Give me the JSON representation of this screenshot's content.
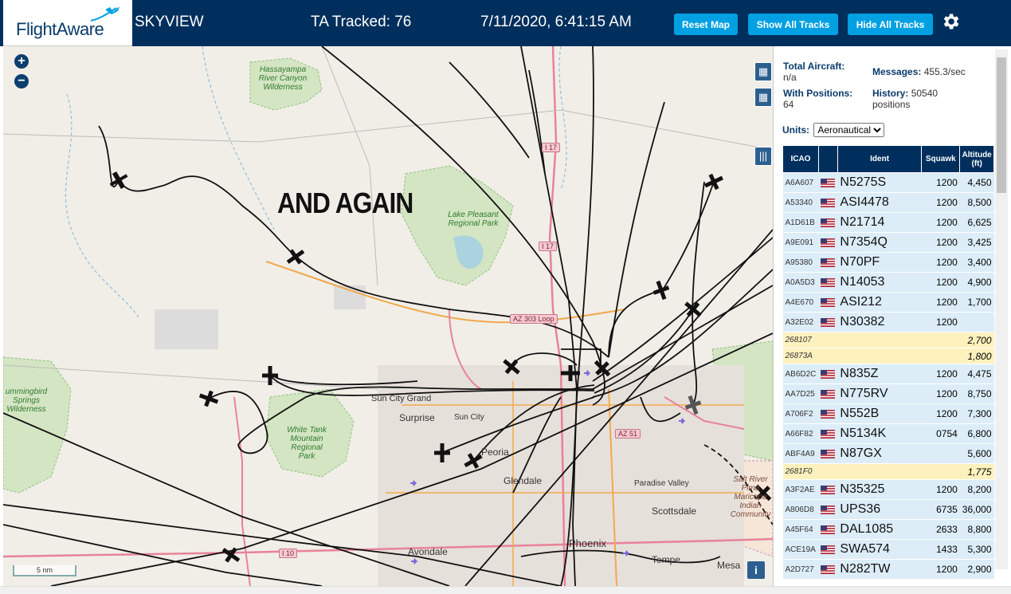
{
  "header": {
    "logo_text": "FlightAware",
    "app_name": "SKYVIEW",
    "tracked": "TA Tracked: 76",
    "datetime": "7/11/2020, 6:41:15 AM",
    "buttons": {
      "reset": "Reset Map",
      "show_all": "Show All Tracks",
      "hide_all": "Hide All Tracks"
    }
  },
  "map": {
    "overlay_text": "AND AGAIN",
    "labels": {
      "sun_city_grand": "Sun City Grand",
      "surprise": "Surprise",
      "sun_city": "Sun City",
      "peoria": "Peoria",
      "glendale": "Glendale",
      "paradise_valley": "Paradise Valley",
      "scottsdale": "Scottsdale",
      "phoenix": "Phoenix",
      "tempe": "Tempe",
      "mesa": "Mesa",
      "avondale": "Avondale"
    },
    "parks": {
      "hassayampa": "Hassayampa River Canyon Wilderness",
      "lake_pleasant": "Lake Pleasant Regional Park",
      "white_tank": "White Tank Mountain Regional Park",
      "hummingbird": "ummingbird Springs Wilderness",
      "salt_river": "Salt River Pima Maricopa Indian Community"
    },
    "shields": {
      "i17_top": "I 17",
      "i17_mid": "I 17",
      "az303": "AZ 303 Loop",
      "az51": "AZ 51",
      "i10": "I 10"
    },
    "scale": "5 nm",
    "icons": {
      "zoom_in": "plus-icon",
      "zoom_out": "minus-icon",
      "map": "map-icon",
      "grid": "grid-icon",
      "columns": "columns-icon",
      "info": "info-icon"
    },
    "zoom_in_label": "+",
    "zoom_out_label": "−",
    "info_label": "i"
  },
  "stats": {
    "total_label": "Total Aircraft:",
    "total_value": "n/a",
    "messages_label": "Messages:",
    "messages_value": "455.3/sec",
    "positions_label": "With Positions:",
    "positions_value": "64",
    "history_label": "History:",
    "history_value": "50540 positions"
  },
  "units": {
    "label": "Units:",
    "selected": "Aeronautical"
  },
  "table": {
    "headers": {
      "icao": "ICAO",
      "ident": "Ident",
      "squawk": "Squawk",
      "altitude": "Altitude (ft)"
    },
    "rows": [
      {
        "icao": "A6A607",
        "flag": true,
        "ident": "N5275S",
        "squawk": "1200",
        "alt": "4,450",
        "nopos": false
      },
      {
        "icao": "A53340",
        "flag": true,
        "ident": "ASI4478",
        "squawk": "1200",
        "alt": "8,500",
        "nopos": false
      },
      {
        "icao": "A1D61B",
        "flag": true,
        "ident": "N21714",
        "squawk": "1200",
        "alt": "6,625",
        "nopos": false
      },
      {
        "icao": "A9E091",
        "flag": true,
        "ident": "N7354Q",
        "squawk": "1200",
        "alt": "3,425",
        "nopos": false
      },
      {
        "icao": "A95380",
        "flag": true,
        "ident": "N70PF",
        "squawk": "1200",
        "alt": "3,400",
        "nopos": false
      },
      {
        "icao": "A0A5D3",
        "flag": true,
        "ident": "N14053",
        "squawk": "1200",
        "alt": "4,900",
        "nopos": false
      },
      {
        "icao": "A4E670",
        "flag": true,
        "ident": "ASI212",
        "squawk": "1200",
        "alt": "1,700",
        "nopos": false
      },
      {
        "icao": "A32E02",
        "flag": true,
        "ident": "N30382",
        "squawk": "1200",
        "alt": "",
        "nopos": false
      },
      {
        "icao": "268107",
        "flag": false,
        "ident": "",
        "squawk": "",
        "alt": "2,700",
        "nopos": true
      },
      {
        "icao": "26873A",
        "flag": false,
        "ident": "",
        "squawk": "",
        "alt": "1,800",
        "nopos": true
      },
      {
        "icao": "AB6D2C",
        "flag": true,
        "ident": "N835Z",
        "squawk": "1200",
        "alt": "4,475",
        "nopos": false
      },
      {
        "icao": "AA7D25",
        "flag": true,
        "ident": "N775RV",
        "squawk": "1200",
        "alt": "8,750",
        "nopos": false
      },
      {
        "icao": "A706F2",
        "flag": true,
        "ident": "N552B",
        "squawk": "1200",
        "alt": "7,300",
        "nopos": false
      },
      {
        "icao": "A66F82",
        "flag": true,
        "ident": "N5134K",
        "squawk": "0754",
        "alt": "6,800",
        "nopos": false
      },
      {
        "icao": "ABF4A9",
        "flag": true,
        "ident": "N87GX",
        "squawk": "",
        "alt": "5,600",
        "nopos": false
      },
      {
        "icao": "2681F0",
        "flag": false,
        "ident": "",
        "squawk": "",
        "alt": "1,775",
        "nopos": true
      },
      {
        "icao": "A3F2AE",
        "flag": true,
        "ident": "N35325",
        "squawk": "1200",
        "alt": "8,200",
        "nopos": false
      },
      {
        "icao": "A806D8",
        "flag": true,
        "ident": "UPS36",
        "squawk": "6735",
        "alt": "36,000",
        "nopos": false
      },
      {
        "icao": "A45F64",
        "flag": true,
        "ident": "DAL1085",
        "squawk": "2633",
        "alt": "8,800",
        "nopos": false
      },
      {
        "icao": "ACE19A",
        "flag": true,
        "ident": "SWA574",
        "squawk": "1433",
        "alt": "5,300",
        "nopos": false
      },
      {
        "icao": "A2D727",
        "flag": true,
        "ident": "N282TW",
        "squawk": "1200",
        "alt": "2,900",
        "nopos": false
      }
    ]
  },
  "colors": {
    "header_bg": "#002f5d",
    "button": "#00a0e2",
    "row_bg": "#dcedf8",
    "nopos_bg": "#fdf1be",
    "map_bg": "#f1eee8"
  }
}
